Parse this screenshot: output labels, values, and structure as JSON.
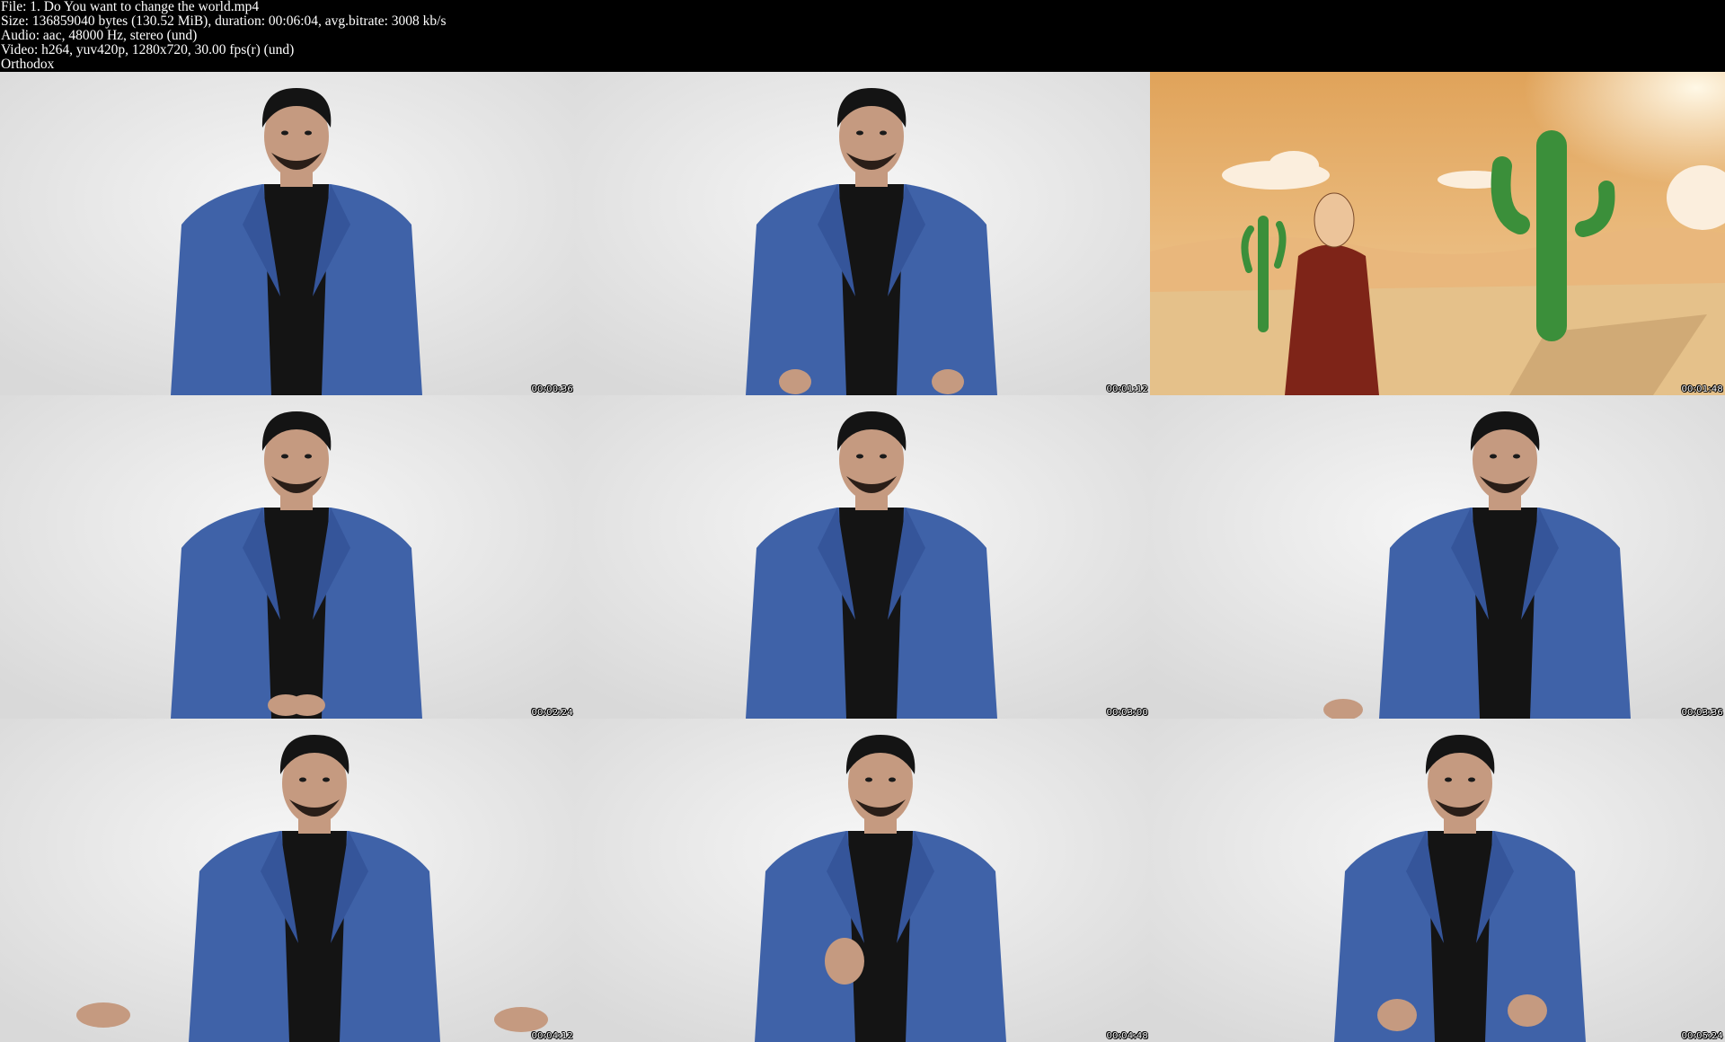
{
  "header": {
    "file_line": "File: 1. Do You want to change the world.mp4",
    "size_line": "Size: 136859040 bytes (130.52 MiB), duration: 00:06:04, avg.bitrate: 3008 kb/s",
    "audio_line": "Audio: aac, 48000 Hz, stereo (und)",
    "video_line": "Video: h264, yuv420p, 1280x720, 30.00 fps(r) (und)",
    "tag_line": "Orthodox"
  },
  "thumbnails": [
    {
      "timestamp": "00:00:36",
      "scene": "presenter",
      "gesture": "none"
    },
    {
      "timestamp": "00:01:12",
      "scene": "presenter",
      "gesture": "hands-open-low"
    },
    {
      "timestamp": "00:01:48",
      "scene": "desert-cartoon-monk",
      "gesture": "none"
    },
    {
      "timestamp": "00:02:24",
      "scene": "presenter",
      "gesture": "hands-together"
    },
    {
      "timestamp": "00:03:00",
      "scene": "presenter",
      "gesture": "none"
    },
    {
      "timestamp": "00:03:36",
      "scene": "presenter",
      "gesture": "hand-left-low"
    },
    {
      "timestamp": "00:04:12",
      "scene": "presenter",
      "gesture": "arms-wide"
    },
    {
      "timestamp": "00:04:48",
      "scene": "presenter",
      "gesture": "hand-raised"
    },
    {
      "timestamp": "00:05:24",
      "scene": "presenter",
      "gesture": "hands-open-mid"
    }
  ],
  "colors": {
    "header_bg": "#000000",
    "header_text": "#ffffff",
    "studio_bg": "#d9d9d9",
    "blazer": "#3f62a8",
    "shirt": "#141414",
    "skin": "#c59a80",
    "hair": "#141414",
    "sky_top": "#e0a35a",
    "sand": "#e5c18a",
    "cactus": "#3b8f3a",
    "robe": "#7e2418"
  }
}
